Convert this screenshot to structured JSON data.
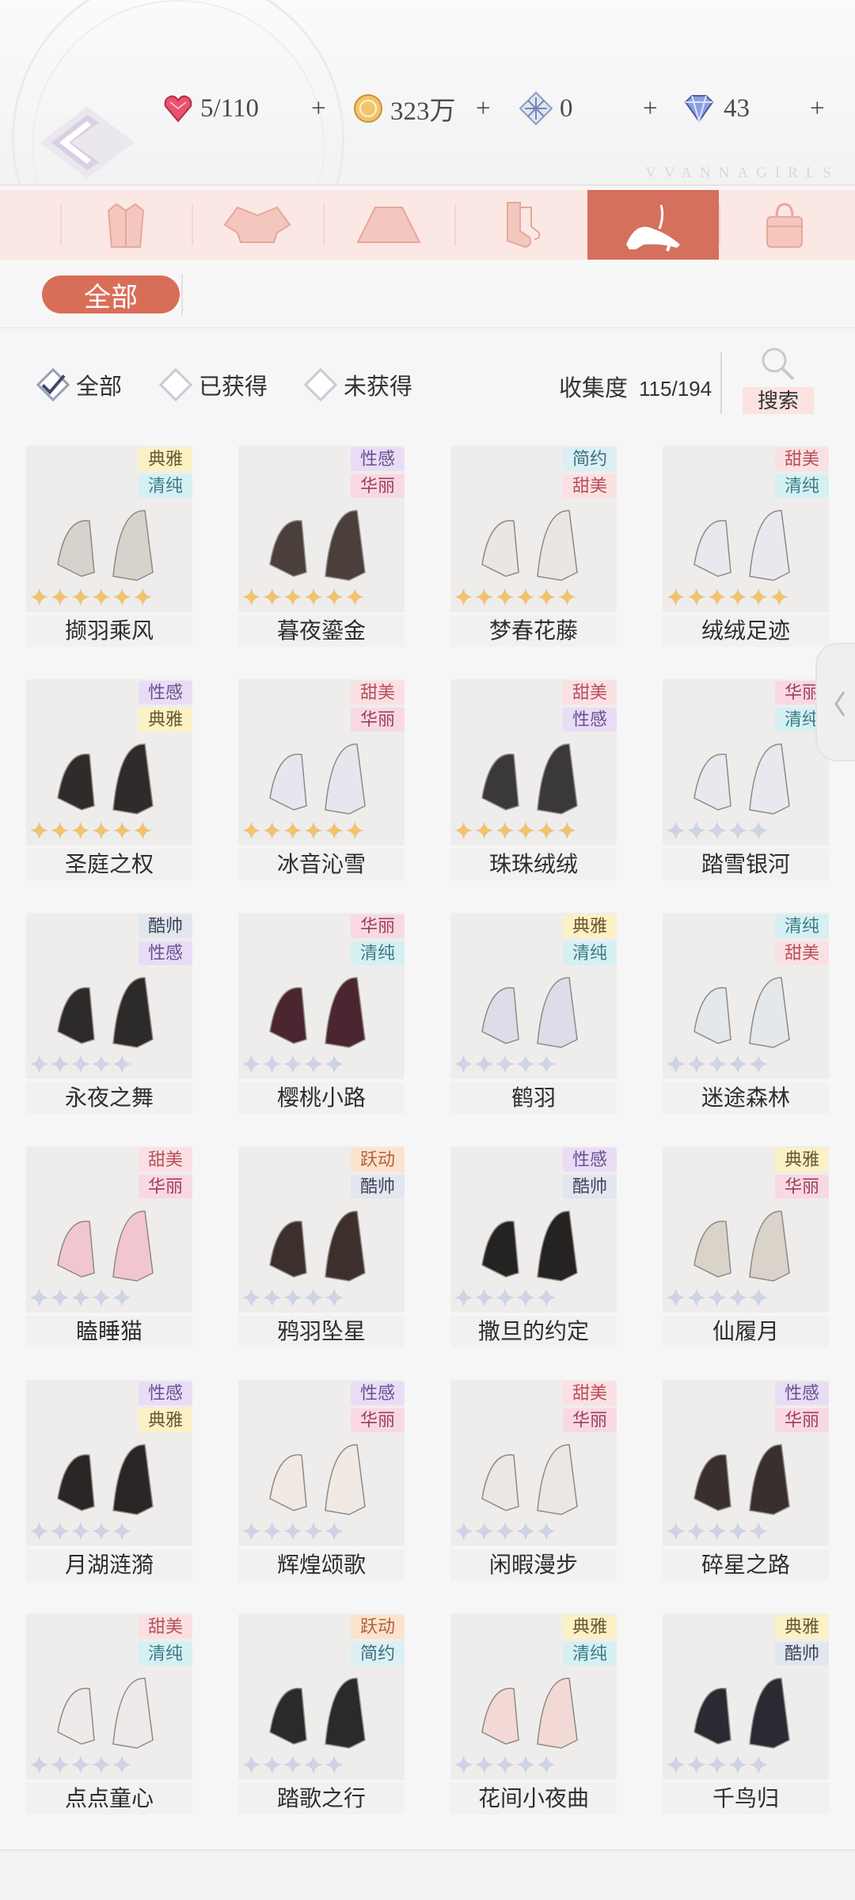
{
  "header": {
    "brand": "VVANNAGIRLS",
    "stamina": "5/110",
    "coins": "323万",
    "crystal": "0",
    "diamonds": "43"
  },
  "tabs": [
    {
      "name": "tab-partial",
      "icon": "partial-icon"
    },
    {
      "name": "tab-coat",
      "icon": "coat-icon"
    },
    {
      "name": "tab-top",
      "icon": "top-icon"
    },
    {
      "name": "tab-skirt",
      "icon": "skirt-icon"
    },
    {
      "name": "tab-socks",
      "icon": "socks-icon"
    },
    {
      "name": "tab-shoes",
      "icon": "high-heel-icon",
      "active": true
    },
    {
      "name": "tab-bag",
      "icon": "bag-icon"
    }
  ],
  "subfilter": {
    "all_label": "全部"
  },
  "filters": {
    "all": "全部",
    "owned": "已获得",
    "not_owned": "未获得",
    "collection_label": "收集度",
    "collection_value": "115/194",
    "search_label": "搜索"
  },
  "items": [
    {
      "name": "撷羽乘风",
      "tags": [
        "典雅",
        "清纯"
      ],
      "stars": "gold"
    },
    {
      "name": "暮夜鎏金",
      "tags": [
        "性感",
        "华丽"
      ],
      "stars": "gold"
    },
    {
      "name": "梦春花藤",
      "tags": [
        "简约",
        "甜美"
      ],
      "stars": "gold"
    },
    {
      "name": "绒绒足迹",
      "tags": [
        "甜美",
        "清纯"
      ],
      "stars": "gold"
    },
    {
      "name": "圣庭之权",
      "tags": [
        "性感",
        "典雅"
      ],
      "stars": "gold"
    },
    {
      "name": "冰音沁雪",
      "tags": [
        "甜美",
        "华丽"
      ],
      "stars": "gold"
    },
    {
      "name": "珠珠绒绒",
      "tags": [
        "甜美",
        "性感"
      ],
      "stars": "gold"
    },
    {
      "name": "踏雪银河",
      "tags": [
        "华丽",
        "清纯"
      ],
      "stars": "silver"
    },
    {
      "name": "永夜之舞",
      "tags": [
        "酷帅",
        "性感"
      ],
      "stars": "silver"
    },
    {
      "name": "樱桃小路",
      "tags": [
        "华丽",
        "清纯"
      ],
      "stars": "silver"
    },
    {
      "name": "鹤羽",
      "tags": [
        "典雅",
        "清纯"
      ],
      "stars": "silver"
    },
    {
      "name": "迷途森林",
      "tags": [
        "清纯",
        "甜美"
      ],
      "stars": "silver"
    },
    {
      "name": "瞌睡猫",
      "tags": [
        "甜美",
        "华丽"
      ],
      "stars": "silver"
    },
    {
      "name": "鸦羽坠星",
      "tags": [
        "跃动",
        "酷帅"
      ],
      "stars": "silver"
    },
    {
      "name": "撒旦的约定",
      "tags": [
        "性感",
        "酷帅"
      ],
      "stars": "silver"
    },
    {
      "name": "仙履月",
      "tags": [
        "典雅",
        "华丽"
      ],
      "stars": "silver"
    },
    {
      "name": "月湖涟漪",
      "tags": [
        "性感",
        "典雅"
      ],
      "stars": "silver"
    },
    {
      "name": "辉煌颂歌",
      "tags": [
        "性感",
        "华丽"
      ],
      "stars": "silver"
    },
    {
      "name": "闲暇漫步",
      "tags": [
        "甜美",
        "华丽"
      ],
      "stars": "silver"
    },
    {
      "name": "碎星之路",
      "tags": [
        "性感",
        "华丽"
      ],
      "stars": "silver"
    },
    {
      "name": "点点童心",
      "tags": [
        "甜美",
        "清纯"
      ],
      "stars": "silver"
    },
    {
      "name": "踏歌之行",
      "tags": [
        "跃动",
        "简约"
      ],
      "stars": "silver"
    },
    {
      "name": "花间小夜曲",
      "tags": [
        "典雅",
        "清纯"
      ],
      "stars": "silver"
    },
    {
      "name": "千鸟归",
      "tags": [
        "典雅",
        "酷帅"
      ],
      "stars": "silver"
    }
  ],
  "colors": {
    "accent": "#d5705e",
    "tab_bg": "#fbe7e3",
    "star_gold": "#f2c36b",
    "star_silver": "#cfd3e8"
  }
}
